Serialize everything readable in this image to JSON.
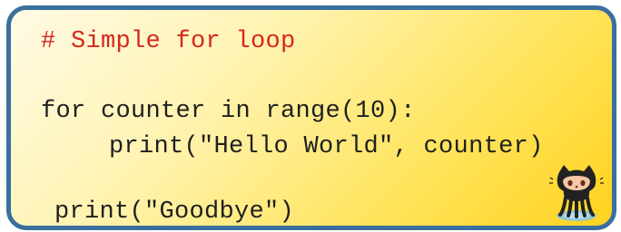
{
  "code": {
    "comment": "# Simple for loop",
    "line_for": "for counter in range(10):",
    "line_print_hello": "print(\"Hello World\", counter)",
    "line_print_goodbye": "print(\"Goodbye\")"
  },
  "colors": {
    "border": "#3a6f9e",
    "comment": "#d7261e",
    "code_text": "#1f1f1f",
    "background_light": "#fffbe6",
    "background_dark": "#ffd21e"
  },
  "icons": {
    "mascot": "octocat-mascot-icon"
  }
}
